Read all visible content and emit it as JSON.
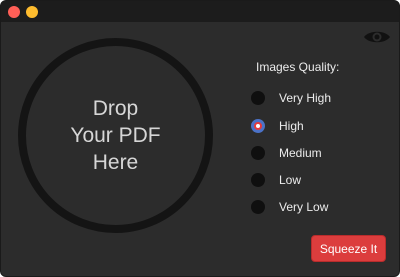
{
  "window": {
    "controls": [
      "close",
      "minimize"
    ]
  },
  "dropzone": {
    "text": "Drop\nYour PDF\nHere"
  },
  "preview": {
    "icon": "eye-icon"
  },
  "quality": {
    "title": "Images Quality:",
    "options": [
      {
        "label": "Very High",
        "selected": false
      },
      {
        "label": "High",
        "selected": true
      },
      {
        "label": "Medium",
        "selected": false
      },
      {
        "label": "Low",
        "selected": false
      },
      {
        "label": "Very Low",
        "selected": false
      }
    ]
  },
  "actions": {
    "squeeze_label": "Squeeze It"
  },
  "colors": {
    "accent": "#dc3d3d",
    "background": "#2c2c2c",
    "selected_ring": "#4b72c7"
  }
}
